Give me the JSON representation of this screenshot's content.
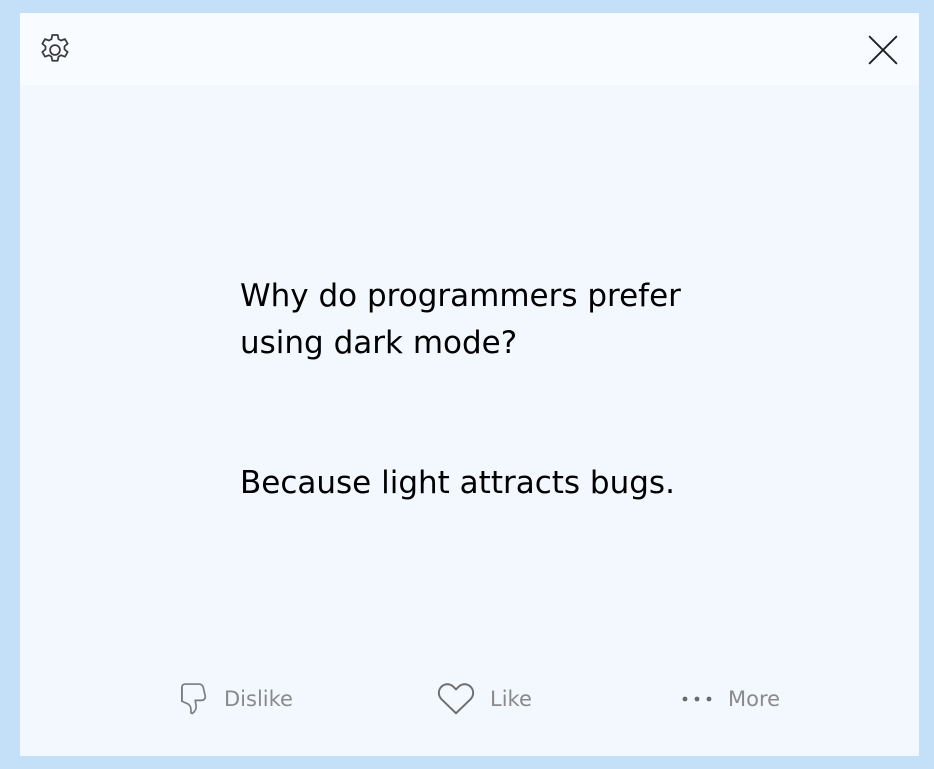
{
  "window": {
    "settings_icon": "gear-icon",
    "close_icon": "close-icon"
  },
  "joke": {
    "setup": "Why do programmers prefer using dark mode?",
    "punchline": "Because light attracts bugs."
  },
  "actions": [
    {
      "label": "Dislike",
      "icon": "thumbs-down-icon"
    },
    {
      "label": "Like",
      "icon": "heart-icon"
    },
    {
      "label": "More",
      "icon": "more-icon"
    }
  ],
  "colors": {
    "window_background": "#c4e0f8",
    "card_background": "#f3f8fe",
    "action_text": "#8a8a8a"
  }
}
